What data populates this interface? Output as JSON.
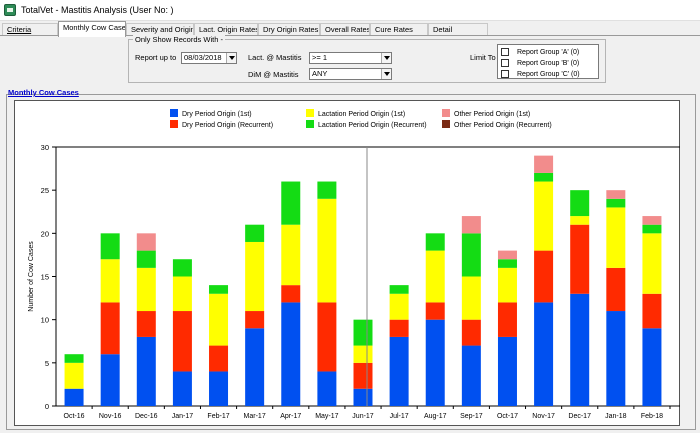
{
  "window": {
    "title": "TotalVet - Mastitis Analysis (User No:         )"
  },
  "tabs": [
    "Criteria",
    "Monthly Cow Cases",
    "Severity and Origin",
    "Lact. Origin Rates",
    "Dry Origin Rates",
    "Overall Rates",
    "Cure Rates",
    "Detail"
  ],
  "filters": {
    "group_title": "Only Show Records With -",
    "report_up_to_label": "Report up to",
    "report_up_to_value": "08/03/2018",
    "lact_label": "Lact. @ Mastitis",
    "lact_value": ">= 1",
    "dim_label": "DiM @ Mastitis",
    "dim_value": "ANY",
    "limit_to_label": "Limit To",
    "report_groups": [
      "Report Group 'A' (0)",
      "Report Group 'B' (0)",
      "Report Group 'C' (0)"
    ]
  },
  "chart_panel": {
    "title": "Monthly Cow Cases"
  },
  "colors": {
    "dry_1st": "#0050f0",
    "dry_recurrent": "#ff2a00",
    "lact_1st": "#ffff00",
    "lact_recurrent": "#14dc14",
    "other_1st": "#f28c8c",
    "other_recurrent": "#7a2a14"
  },
  "chart_data": {
    "type": "bar",
    "stacked": true,
    "ylabel": "Number of Cow Cases",
    "ylim": [
      0,
      30
    ],
    "yticks": [
      0,
      5,
      10,
      15,
      20,
      25,
      30
    ],
    "grid": false,
    "legend_position": "top",
    "categories": [
      "Oct-16",
      "Nov-16",
      "Dec-16",
      "Jan-17",
      "Feb-17",
      "Mar-17",
      "Apr-17",
      "May-17",
      "Jun-17",
      "Jul-17",
      "Aug-17",
      "Sep-17",
      "Oct-17",
      "Nov-17",
      "Dec-17",
      "Jan-18",
      "Feb-18"
    ],
    "series": [
      {
        "name": "Dry Period Origin (1st)",
        "color_key": "dry_1st",
        "values": [
          2,
          6,
          8,
          4,
          4,
          9,
          12,
          4,
          2,
          8,
          10,
          7,
          8,
          12,
          13,
          11,
          9
        ]
      },
      {
        "name": "Dry Period Origin (Recurrent)",
        "color_key": "dry_recurrent",
        "values": [
          0,
          6,
          3,
          7,
          3,
          2,
          2,
          8,
          3,
          2,
          2,
          3,
          4,
          6,
          8,
          5,
          4
        ]
      },
      {
        "name": "Lactation Period Origin (1st)",
        "color_key": "lact_1st",
        "values": [
          3,
          5,
          5,
          4,
          6,
          8,
          7,
          12,
          2,
          3,
          6,
          5,
          4,
          8,
          1,
          7,
          7
        ]
      },
      {
        "name": "Lactation Period Origin (Recurrent)",
        "color_key": "lact_recurrent",
        "values": [
          1,
          3,
          2,
          2,
          1,
          2,
          5,
          2,
          3,
          1,
          2,
          5,
          1,
          1,
          3,
          1,
          1
        ]
      },
      {
        "name": "Other Period Origin (1st)",
        "color_key": "other_1st",
        "values": [
          0,
          0,
          2,
          0,
          0,
          0,
          0,
          0,
          0,
          0,
          0,
          2,
          1,
          2,
          0,
          1,
          1
        ]
      },
      {
        "name": "Other Period Origin (Recurrent)",
        "color_key": "other_recurrent",
        "values": [
          0,
          0,
          0,
          0,
          0,
          0,
          0,
          0,
          0,
          0,
          0,
          0,
          0,
          0,
          0,
          0,
          0
        ]
      }
    ]
  }
}
